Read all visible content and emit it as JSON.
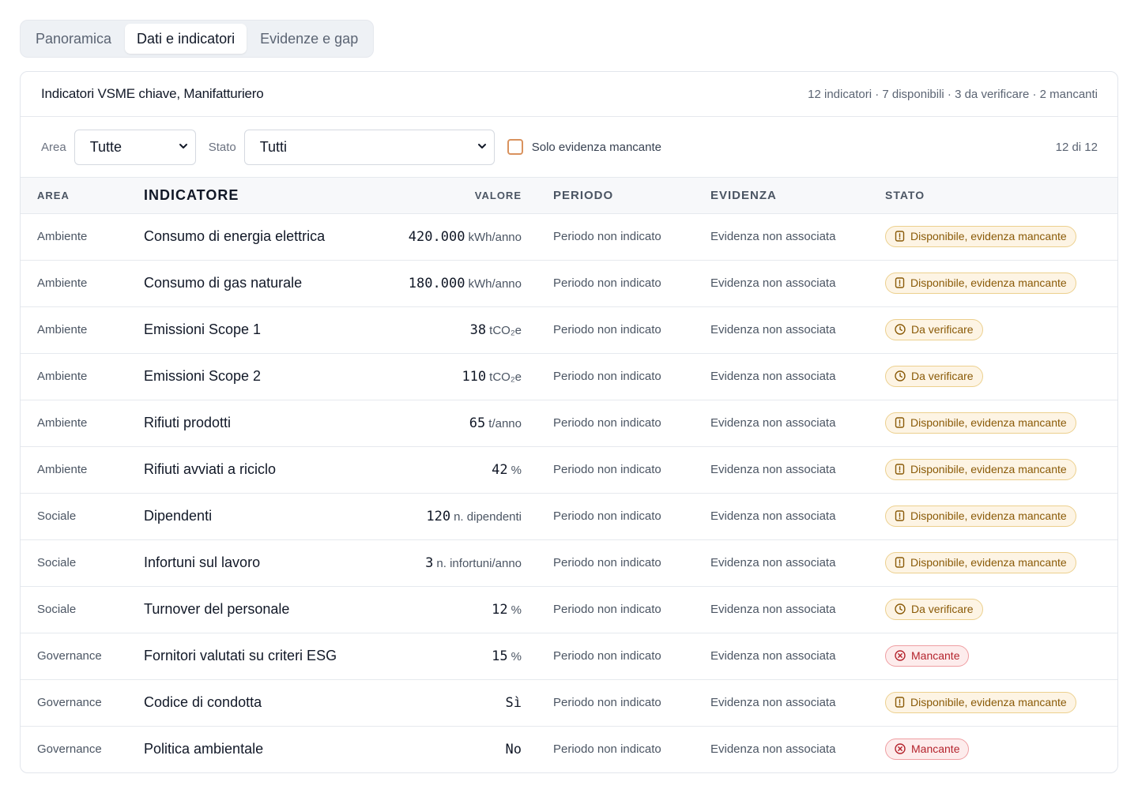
{
  "tabs": [
    {
      "label": "Panoramica",
      "active": false
    },
    {
      "label": "Dati e indicatori",
      "active": true
    },
    {
      "label": "Evidenze e gap",
      "active": false
    }
  ],
  "card": {
    "title": "Indicatori VSME chiave, Manifatturiero",
    "summary": "12 indicatori · 7 disponibili · 3 da verificare · 2 mancanti"
  },
  "filters": {
    "area_label": "Area",
    "area_value": "Tutte",
    "stato_label": "Stato",
    "stato_value": "Tutti",
    "only_missing_label": "Solo evidenza mancante",
    "only_missing_checked": false,
    "count": "12 di 12"
  },
  "table": {
    "headers": {
      "area": "AREA",
      "indicator": "INDICATORE",
      "value": "VALORE",
      "period": "PERIODO",
      "evidence": "EVIDENZA",
      "status": "STATO"
    },
    "rows": [
      {
        "area": "Ambiente",
        "indicator": "Consumo di energia elettrica",
        "value": "420.000",
        "unit": "kWh/anno",
        "period": "Periodo non indicato",
        "evidence": "Evidenza non associata",
        "status": "Disponibile, evidenza mancante",
        "status_kind": "doc"
      },
      {
        "area": "Ambiente",
        "indicator": "Consumo di gas naturale",
        "value": "180.000",
        "unit": "kWh/anno",
        "period": "Periodo non indicato",
        "evidence": "Evidenza non associata",
        "status": "Disponibile, evidenza mancante",
        "status_kind": "doc"
      },
      {
        "area": "Ambiente",
        "indicator": "Emissioni Scope 1",
        "value": "38",
        "unit": "tCO₂e",
        "period": "Periodo non indicato",
        "evidence": "Evidenza non associata",
        "status": "Da verificare",
        "status_kind": "clock"
      },
      {
        "area": "Ambiente",
        "indicator": "Emissioni Scope 2",
        "value": "110",
        "unit": "tCO₂e",
        "period": "Periodo non indicato",
        "evidence": "Evidenza non associata",
        "status": "Da verificare",
        "status_kind": "clock"
      },
      {
        "area": "Ambiente",
        "indicator": "Rifiuti prodotti",
        "value": "65",
        "unit": "t/anno",
        "period": "Periodo non indicato",
        "evidence": "Evidenza non associata",
        "status": "Disponibile, evidenza mancante",
        "status_kind": "doc"
      },
      {
        "area": "Ambiente",
        "indicator": "Rifiuti avviati a riciclo",
        "value": "42",
        "unit": "%",
        "period": "Periodo non indicato",
        "evidence": "Evidenza non associata",
        "status": "Disponibile, evidenza mancante",
        "status_kind": "doc"
      },
      {
        "area": "Sociale",
        "indicator": "Dipendenti",
        "value": "120",
        "unit": "n. dipendenti",
        "period": "Periodo non indicato",
        "evidence": "Evidenza non associata",
        "status": "Disponibile, evidenza mancante",
        "status_kind": "doc"
      },
      {
        "area": "Sociale",
        "indicator": "Infortuni sul lavoro",
        "value": "3",
        "unit": "n. infortuni/anno",
        "period": "Periodo non indicato",
        "evidence": "Evidenza non associata",
        "status": "Disponibile, evidenza mancante",
        "status_kind": "doc"
      },
      {
        "area": "Sociale",
        "indicator": "Turnover del personale",
        "value": "12",
        "unit": "%",
        "period": "Periodo non indicato",
        "evidence": "Evidenza non associata",
        "status": "Da verificare",
        "status_kind": "clock"
      },
      {
        "area": "Governance",
        "indicator": "Fornitori valutati su criteri ESG",
        "value": "15",
        "unit": "%",
        "period": "Periodo non indicato",
        "evidence": "Evidenza non associata",
        "status": "Mancante",
        "status_kind": "missing"
      },
      {
        "area": "Governance",
        "indicator": "Codice di condotta",
        "value": "Sì",
        "unit": "",
        "period": "Periodo non indicato",
        "evidence": "Evidenza non associata",
        "status": "Disponibile, evidenza mancante",
        "status_kind": "doc"
      },
      {
        "area": "Governance",
        "indicator": "Politica ambientale",
        "value": "No",
        "unit": "",
        "period": "Periodo non indicato",
        "evidence": "Evidenza non associata",
        "status": "Mancante",
        "status_kind": "missing"
      }
    ]
  },
  "colors": {
    "badge_amber_bg": "#fdf4e4",
    "badge_amber_text": "#8a5a07",
    "badge_red_bg": "#fdecec",
    "badge_red_text": "#b4232c",
    "checkbox_border": "#d9925e"
  }
}
